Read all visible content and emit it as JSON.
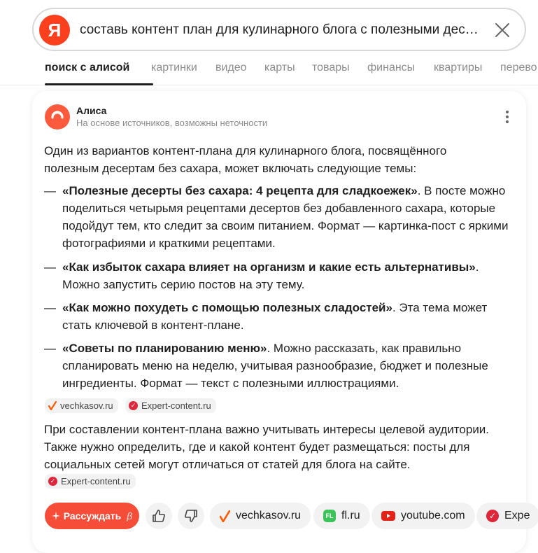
{
  "search": {
    "logo_letter": "Я",
    "query": "составь контент план для кулинарного блога с полезными десертами без сахара"
  },
  "tabs": [
    {
      "label": "поиск с алисой",
      "active": true
    },
    {
      "label": "картинки"
    },
    {
      "label": "видео"
    },
    {
      "label": "карты"
    },
    {
      "label": "товары"
    },
    {
      "label": "финансы"
    },
    {
      "label": "квартиры"
    },
    {
      "label": "перево"
    }
  ],
  "answer": {
    "author": "Алиса",
    "subtitle": "На основе источников, возможны неточности",
    "intro": "Один из вариантов контент-плана для кулинарного блога, посвящённого полезным десертам без сахара, может включать следующие темы:",
    "items": [
      {
        "bold": "«Полезные десерты без сахара: 4 рецепта для сладкоежек»",
        "text": ". В посте можно поделиться четырьмя рецептами десертов без добавленного сахара, которые подойдут тем, кто следит за своим питанием. Формат — картинка-пост с яркими фотографиями и краткими рецептами."
      },
      {
        "bold": "«Как избыток сахара влияет на организм и какие есть альтернативы»",
        "text": ". Можно запустить серию постов на эту тему."
      },
      {
        "bold": "«Как можно похудеть с помощью полезных сладостей»",
        "text": ". Эта тема может стать ключевой в контент-плане."
      },
      {
        "bold": "«Советы по планированию меню»",
        "text": ". Можно рассказать, как правильно спланировать меню на неделю, учитывая разнообразие, бюджет и полезные ингредиенты. Формат — текст с полезными иллюстрациями."
      }
    ],
    "sources_1": [
      "vechkasov.ru",
      "Expert-content.ru"
    ],
    "outro": "При составлении контент-плана важно учитывать интересы целевой аудитории. Также нужно определить, где и какой контент будет размещаться: посты для социальных сетей могут отличаться от статей для блога на сайте.",
    "sources_2": [
      "Expert-content.ru"
    ]
  },
  "actions": {
    "discuss": "Рассуждать",
    "beta": "β",
    "links": [
      "vechkasov.ru",
      "fl.ru",
      "youtube.com",
      "Expe"
    ]
  },
  "colors": {
    "brand": "#fc3f1d",
    "alice": "#fc5a3c",
    "discuss": "#f64d38",
    "vechkasov_check": "#ff5a00",
    "expert_badge": "#e0263a",
    "fl_green": "#3cc35a",
    "youtube_red": "#e62117"
  }
}
